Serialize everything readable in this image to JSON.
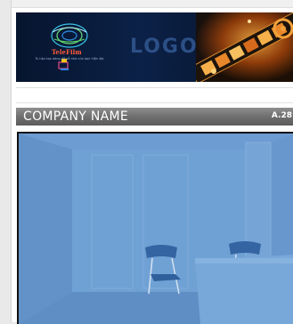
{
  "header": {
    "logo_text": "LOGO",
    "brand_name": "TeleFilm",
    "brand_tagline": "Tu hậu tạo dòng đồ gỗ nhà của bạn hiện đại"
  },
  "section": {
    "title": "COMPANY NAME",
    "code": "A.28"
  },
  "colors": {
    "title_bar": "#6f6f6f",
    "photo_tint": "#6f9fd3",
    "banner_bg": "#0b2147"
  }
}
